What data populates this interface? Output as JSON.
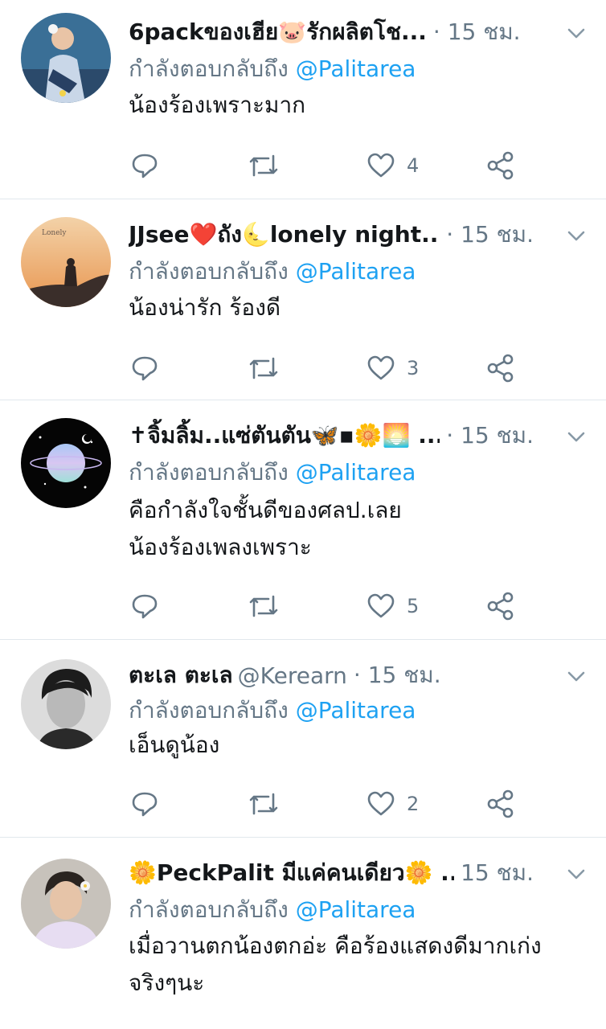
{
  "reply_prefix": "กำลังตอบกลับถึง",
  "colors": {
    "link": "#1da1f2",
    "muted": "#657786",
    "text": "#14171a",
    "divider": "#e1e8ed"
  },
  "tweets": [
    {
      "name": "6packของเฮีย🐷รักผลิตโช...",
      "handle": "",
      "meta": "· 15 ชม.",
      "mention": "@Palitarea",
      "text": [
        "น้องร้องเพราะมาก"
      ],
      "likes": "4",
      "avatar_icon": "person-photo-avatar"
    },
    {
      "name": "JJsee❤️ถัง🌜lonely night...",
      "handle": "",
      "meta": "· 15 ชม.",
      "mention": "@Palitarea",
      "text": [
        "น้องน่ารัก ร้องดี"
      ],
      "likes": "3",
      "avatar_icon": "sunset-photo-avatar"
    },
    {
      "name": "✝จิ้มลิ้ม..แซ่ตันตัน🦋▪🌼🌅 ...",
      "handle": "",
      "meta": "· 15 ชม.",
      "mention": "@Palitarea",
      "text": [
        "คือกำลังใจชั้นดีของศลป.เลย",
        "น้องร้องเพลงเพราะ"
      ],
      "likes": "5",
      "avatar_icon": "planet-avatar"
    },
    {
      "name": "ตะเล ตะเล",
      "handle": "@Kerearn",
      "meta": "· 15 ชม.",
      "mention": "@Palitarea",
      "text": [
        "เอ็นดูน้อง"
      ],
      "likes": "2",
      "avatar_icon": "bw-portrait-avatar"
    },
    {
      "name": "🌼PeckPalit มีแค่คนเดียว🌼 ..:",
      "handle": "",
      "meta": "15 ชม.",
      "mention": "@Palitarea",
      "text": [
        "เมื่อวานตกน้องตกอ่ะ คือร้องแสดงดีมากเก่ง",
        "จริงๆนะ"
      ],
      "likes": "",
      "avatar_icon": "portrait-photo-avatar"
    }
  ]
}
